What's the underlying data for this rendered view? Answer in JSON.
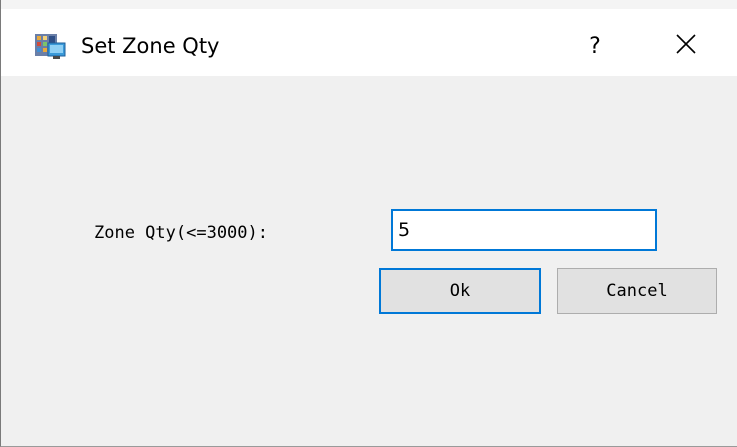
{
  "dialog": {
    "title": "Set Zone Qty",
    "app_icon": "app-window-icon",
    "help_label": "?",
    "close_icon": "close-icon"
  },
  "form": {
    "zone_qty_label": "Zone Qty(<=3000):",
    "zone_qty_value": "5"
  },
  "buttons": {
    "ok_label": "Ok",
    "cancel_label": "Cancel"
  },
  "colors": {
    "focus_accent": "#0078d7",
    "button_face": "#e1e1e1",
    "dialog_background": "#f0f0f0"
  }
}
